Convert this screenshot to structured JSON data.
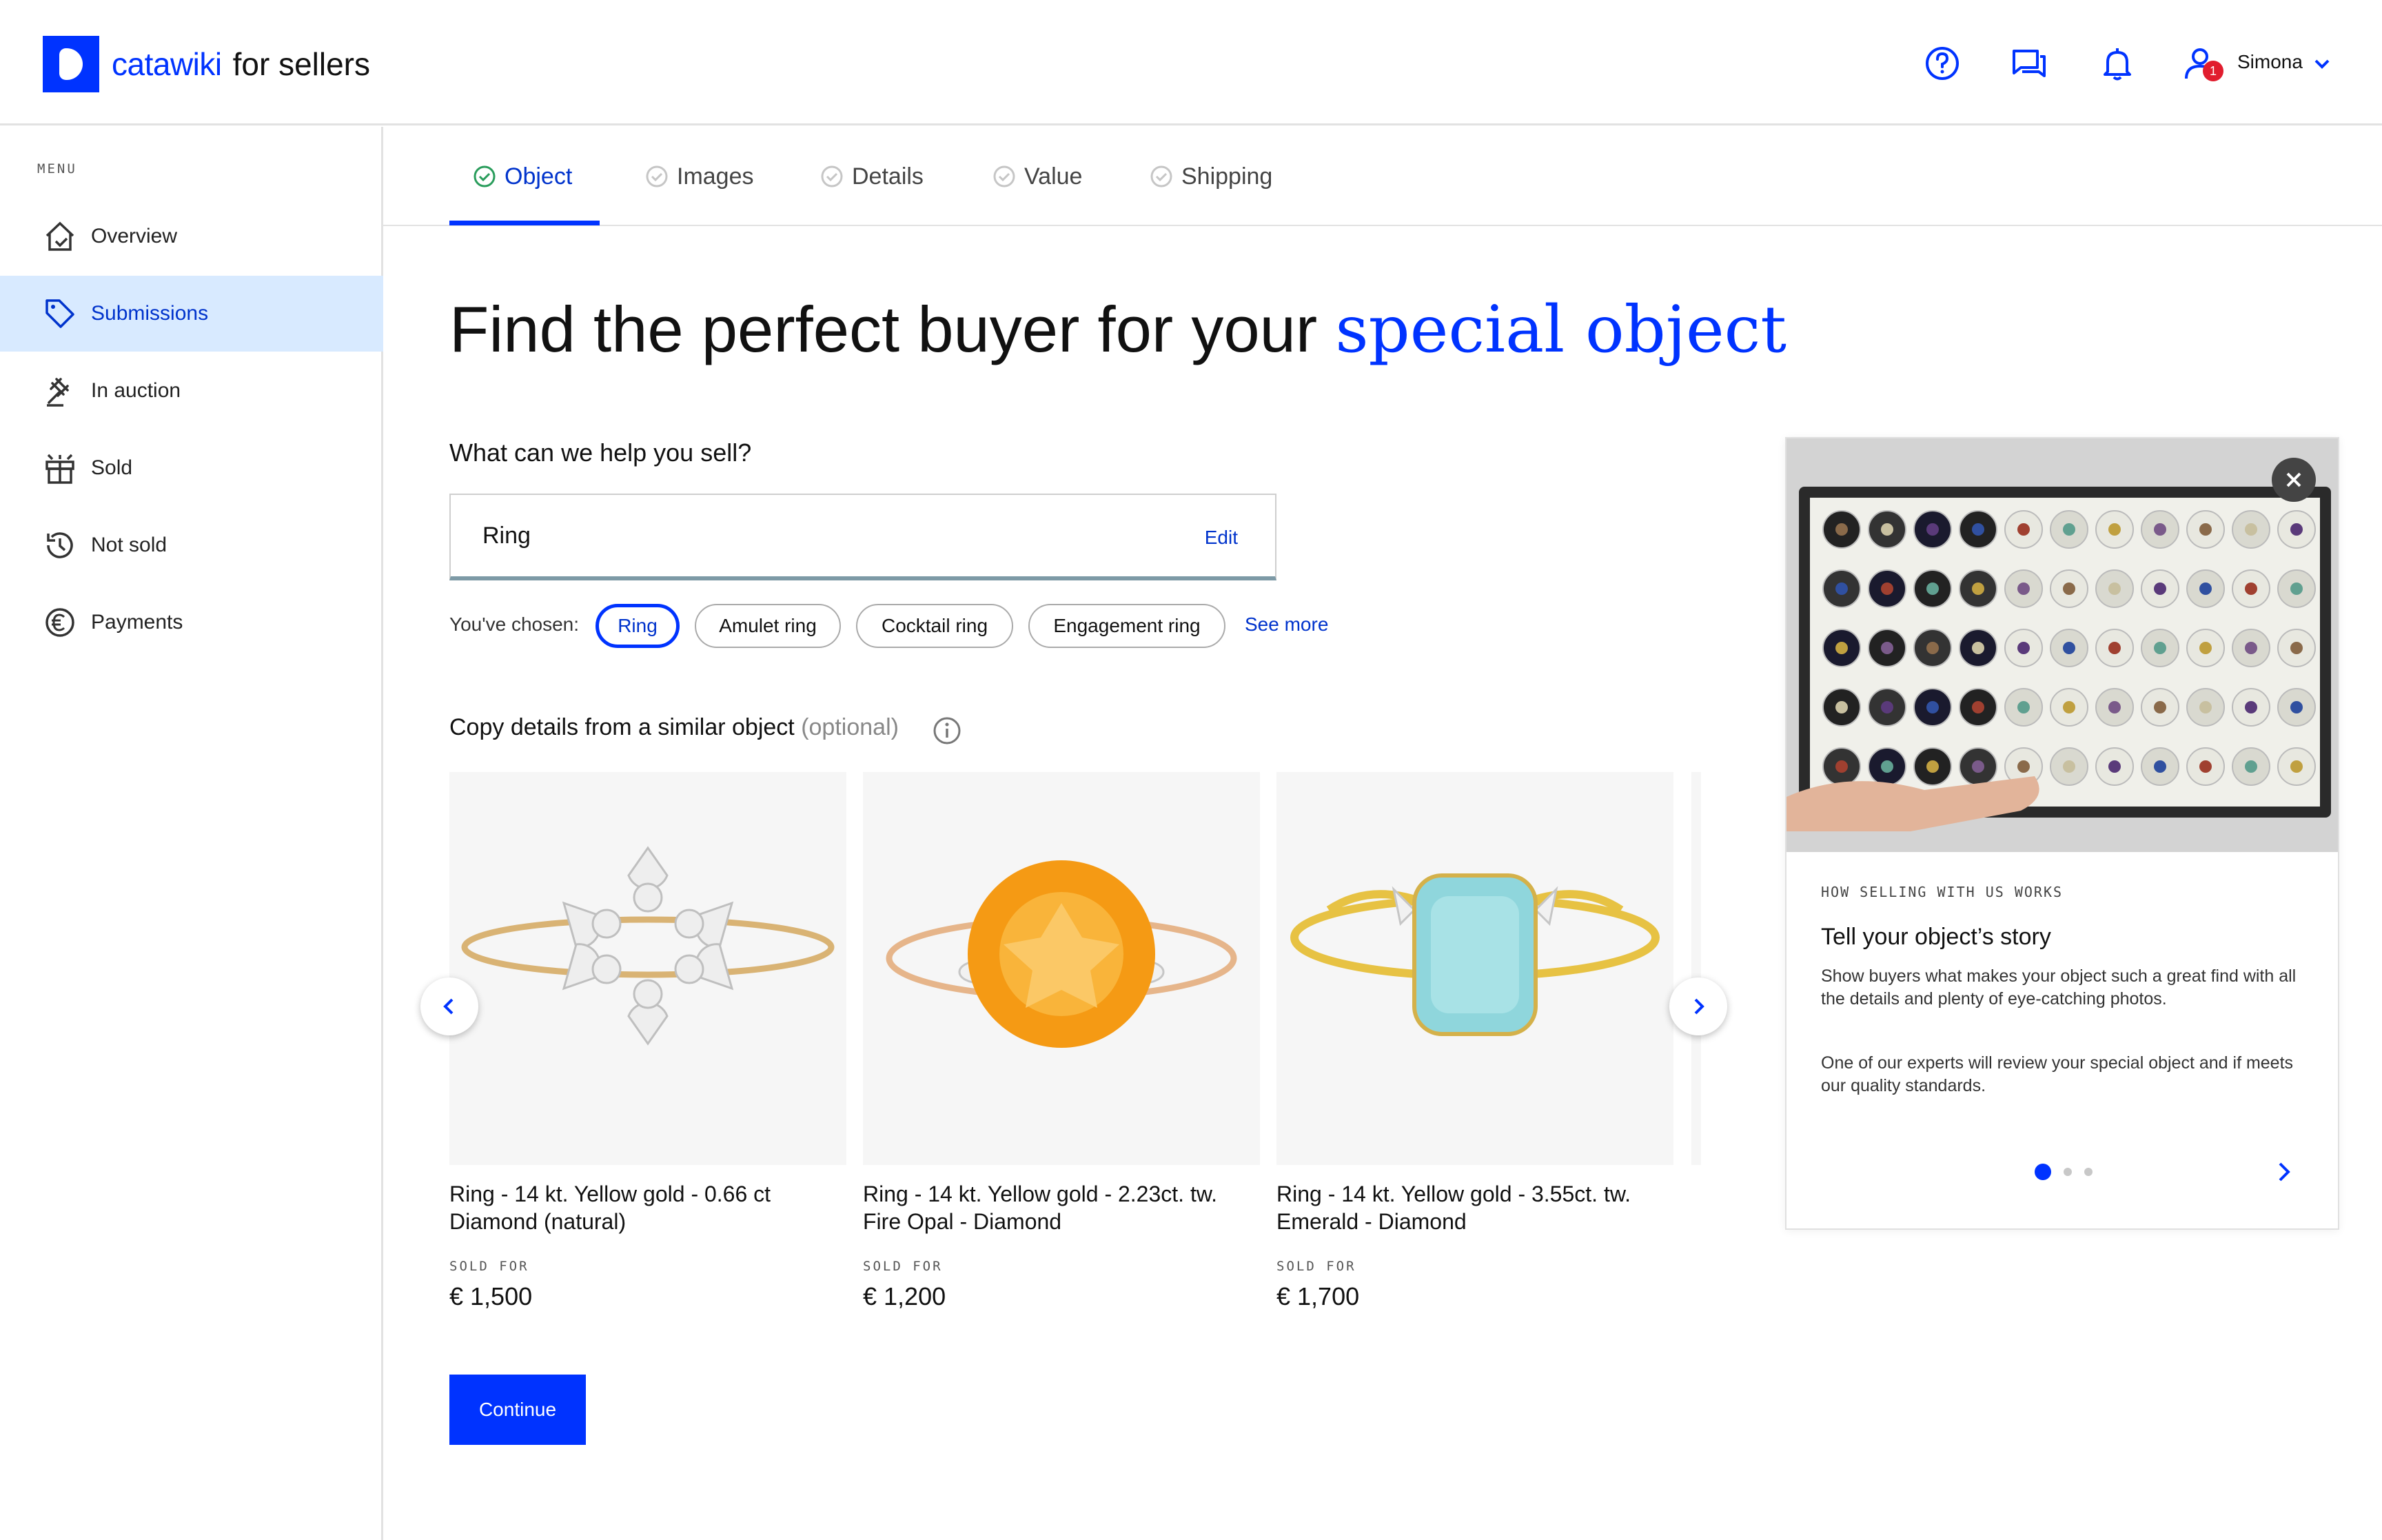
{
  "header": {
    "brand": "catawiki",
    "brand_sub": "for sellers",
    "user_name": "Simona",
    "notification_count": "1"
  },
  "sidebar": {
    "menu_label": "MENU",
    "items": [
      {
        "label": "Overview",
        "icon": "home-icon"
      },
      {
        "label": "Submissions",
        "icon": "tag-icon",
        "active": true
      },
      {
        "label": "In auction",
        "icon": "gavel-icon"
      },
      {
        "label": "Sold",
        "icon": "gift-icon"
      },
      {
        "label": "Not sold",
        "icon": "history-icon"
      },
      {
        "label": "Payments",
        "icon": "euro-icon"
      }
    ]
  },
  "tabs": [
    {
      "label": "Object",
      "active": true
    },
    {
      "label": "Images"
    },
    {
      "label": "Details"
    },
    {
      "label": "Value"
    },
    {
      "label": "Shipping"
    }
  ],
  "main": {
    "headline": "Find the perfect buyer for your",
    "headline_accent": "special object",
    "question": "What can we help you sell?",
    "input_value": "Ring",
    "edit_label": "Edit",
    "chosen_label": "You've chosen:",
    "chips": [
      "Ring",
      "Amulet ring",
      "Cocktail ring",
      "Engagement ring"
    ],
    "see_more": "See more",
    "copy_label": "Copy details from a similar object",
    "copy_optional": "(optional)",
    "continue_label": "Continue"
  },
  "cards": [
    {
      "title_line1": "Ring - 14 kt. Yellow gold - 0.66 ct",
      "title_line2": "Diamond (natural)",
      "sold_label": "SOLD FOR",
      "price": "€ 1,500"
    },
    {
      "title_line1": "Ring - 14 kt. Yellow gold - 2.23ct. tw.",
      "title_line2": "Fire Opal - Diamond",
      "sold_label": "SOLD FOR",
      "price": "€ 1,200"
    },
    {
      "title_line1": "Ring - 14 kt. Yellow gold - 3.55ct. tw.",
      "title_line2": "Emerald - Diamond",
      "sold_label": "SOLD FOR",
      "price": "€ 1,700"
    }
  ],
  "panel": {
    "kicker": "HOW SELLING WITH US WORKS",
    "title": "Tell your object’s story",
    "p1": "Show buyers what makes your object such a great find with all the details and plenty of eye-catching photos.",
    "p2": "One of our experts will review your special object and if meets our quality standards."
  },
  "colors": {
    "accent": "#0033ff",
    "active_nav_bg": "#d8eaff",
    "badge": "#e11d2e"
  }
}
